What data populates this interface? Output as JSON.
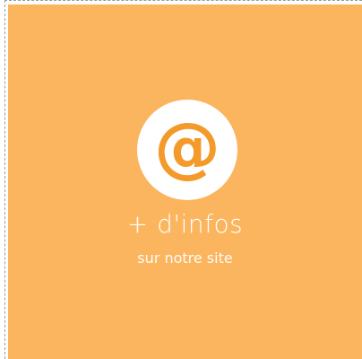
{
  "card": {
    "icon": "at-sign-icon",
    "icon_glyph": "@",
    "title": "+ d'infos",
    "subtitle": "sur notre site",
    "colors": {
      "background": "#fbb55f",
      "accent": "#f39a2a",
      "text": "#ffffff"
    }
  }
}
